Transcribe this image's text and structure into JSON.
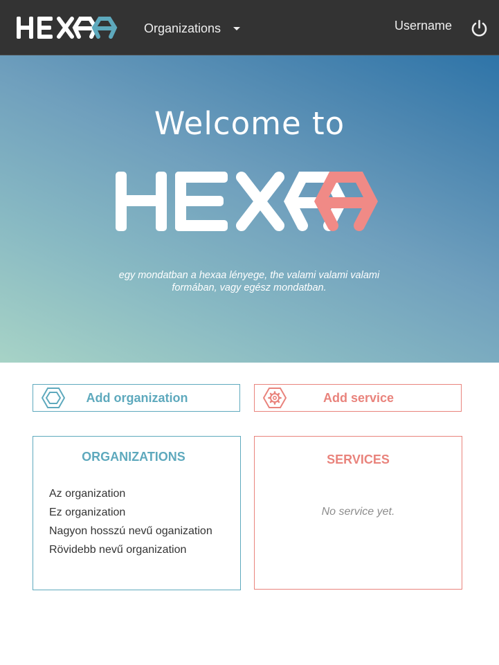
{
  "colors": {
    "topbar": "#333333",
    "teal": "#5ea9bd",
    "coral": "#e9837c",
    "text": "#333333",
    "muted": "#8c8c8c"
  },
  "header": {
    "logo_text": "HEXAA",
    "org_menu_label": "Organizations",
    "username": "Username",
    "icons": [
      "logo",
      "chevron-down-icon",
      "power-icon"
    ]
  },
  "hero": {
    "welcome": "Welcome to",
    "logo_text": "HEXAA",
    "tagline": "egy mondatban a hexaa lényege, the valami valami valami formában, vagy egész mondatban."
  },
  "actions": {
    "add_organization": {
      "label": "Add organization",
      "icon": "hexagon-icon"
    },
    "add_service": {
      "label": "Add service",
      "icon": "gear-icon"
    }
  },
  "organizations_panel": {
    "title": "ORGANIZATIONS",
    "items": [
      "Az organization",
      "Ez organization",
      "Nagyon hosszú nevű oganization",
      "Rövidebb nevű organization"
    ]
  },
  "services_panel": {
    "title": "SERVICES",
    "empty_text": "No service yet."
  }
}
